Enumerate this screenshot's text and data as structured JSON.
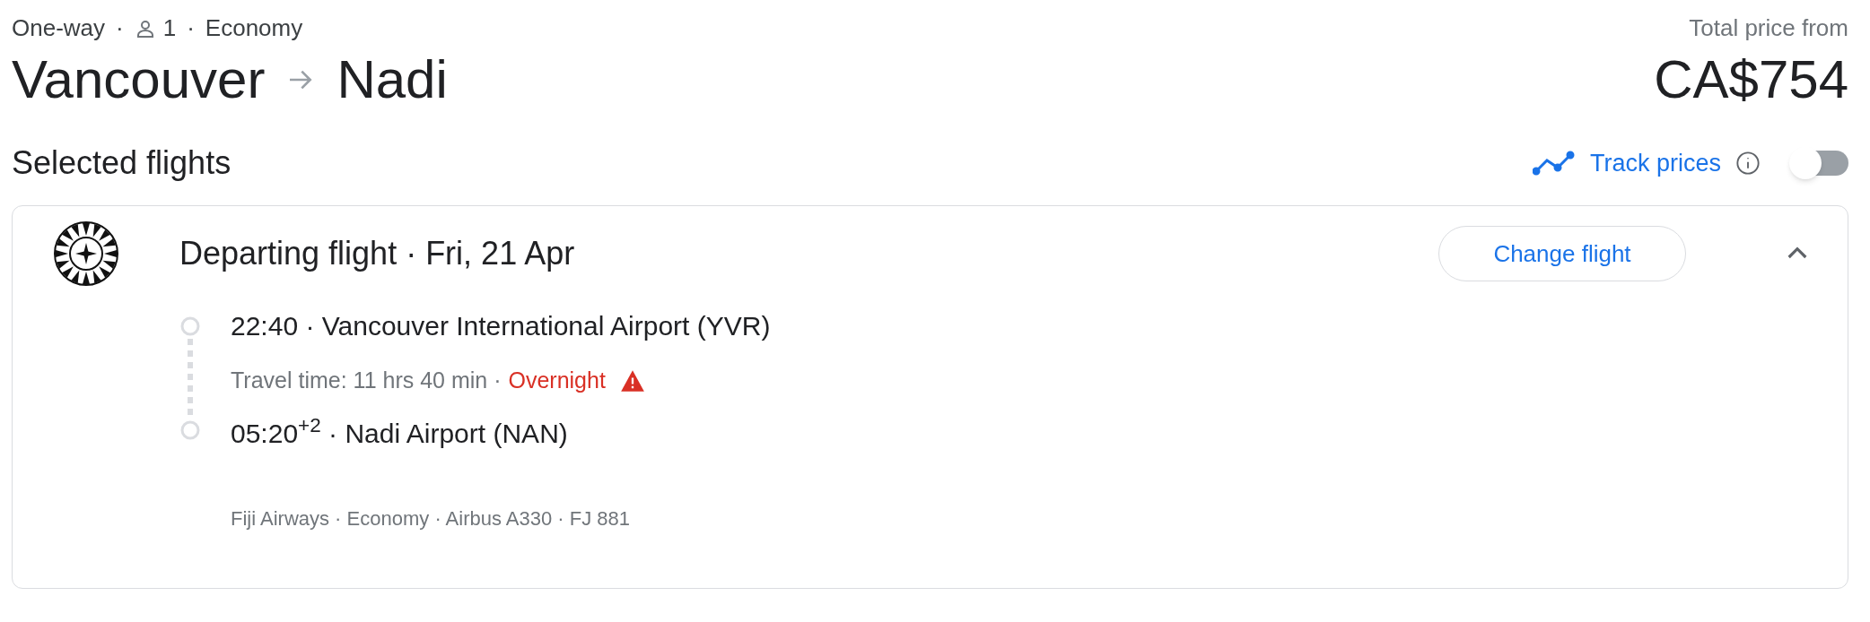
{
  "trip": {
    "type": "One-way",
    "separator": "·",
    "passengers": "1",
    "cabin": "Economy"
  },
  "route": {
    "origin": "Vancouver",
    "destination": "Nadi"
  },
  "price": {
    "label": "Total price from",
    "amount": "CA$754"
  },
  "section_title": "Selected flights",
  "track_prices": {
    "label": "Track prices",
    "on": false
  },
  "flight": {
    "title": "Departing flight · Fri, 21 Apr",
    "change_button": "Change flight",
    "expanded": true,
    "departure": "22:40 · Vancouver International Airport (YVR)",
    "travel_time": "Travel time: 11 hrs 40 min ·",
    "warning": "Overnight",
    "arrival": "05:20$^{+2}$ · Nadi Airport (NAN)",
    "details": "Fiji Airways · Economy · Airbus A330 · FJ 881"
  }
}
